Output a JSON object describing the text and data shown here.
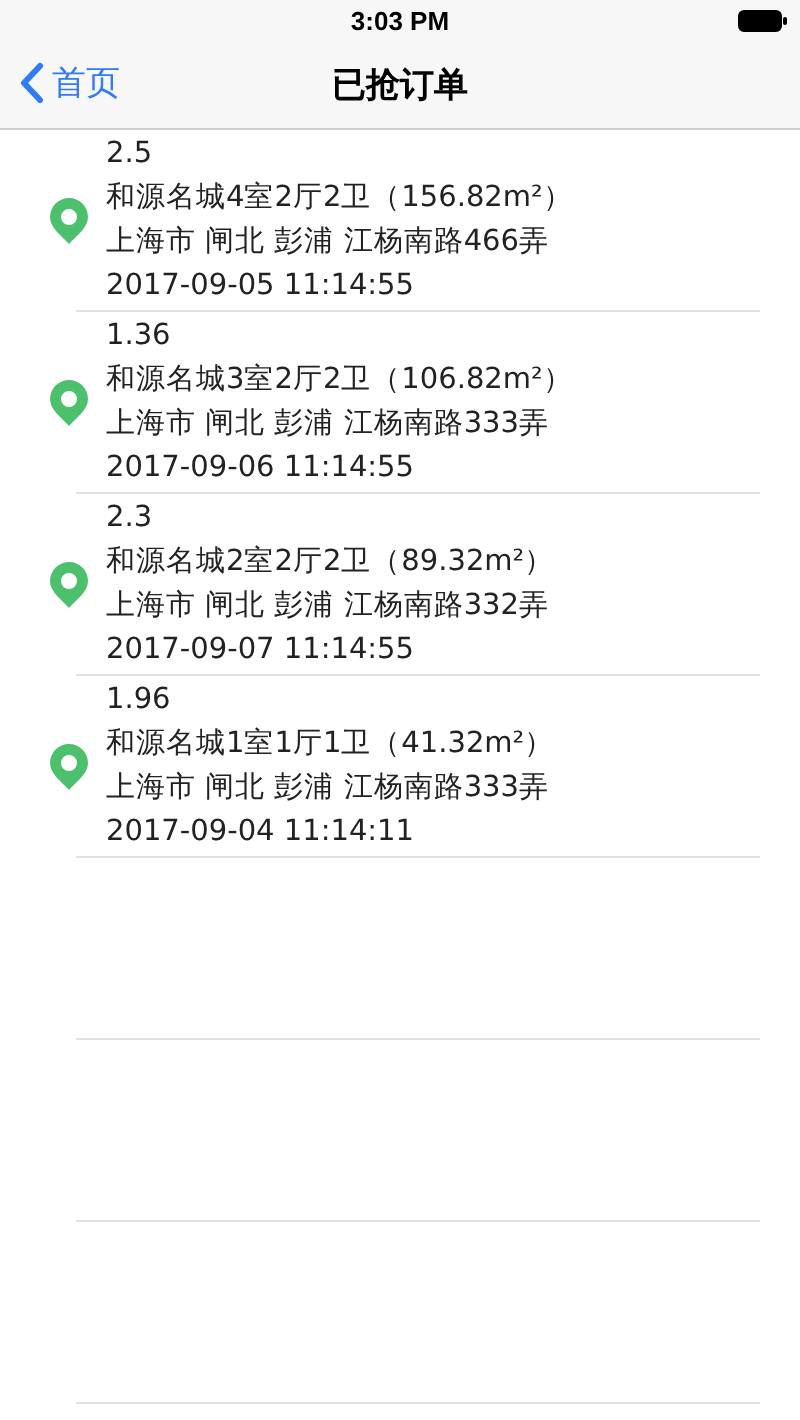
{
  "status_bar": {
    "time": "3:03 PM"
  },
  "nav_bar": {
    "back": "首页",
    "title": "已抢订单"
  },
  "orders": [
    {
      "price": "2.5",
      "name": "和源名城4室2厅2卫（156.82m²）",
      "address": "上海市 闸北 彭浦 江杨南路466弄",
      "time": "2017-09-05 11:14:55"
    },
    {
      "price": "1.36",
      "name": "和源名城3室2厅2卫（106.82m²）",
      "address": "上海市 闸北 彭浦 江杨南路333弄",
      "time": "2017-09-06 11:14:55"
    },
    {
      "price": "2.3",
      "name": "和源名城2室2厅2卫（89.32m²）",
      "address": "上海市 闸北 彭浦 江杨南路332弄",
      "time": "2017-09-07 11:14:55"
    },
    {
      "price": "1.96",
      "name": "和源名城1室1厅1卫（41.32m²）",
      "address": "上海市 闸北 彭浦 江杨南路333弄",
      "time": "2017-09-04 11:14:11"
    }
  ]
}
